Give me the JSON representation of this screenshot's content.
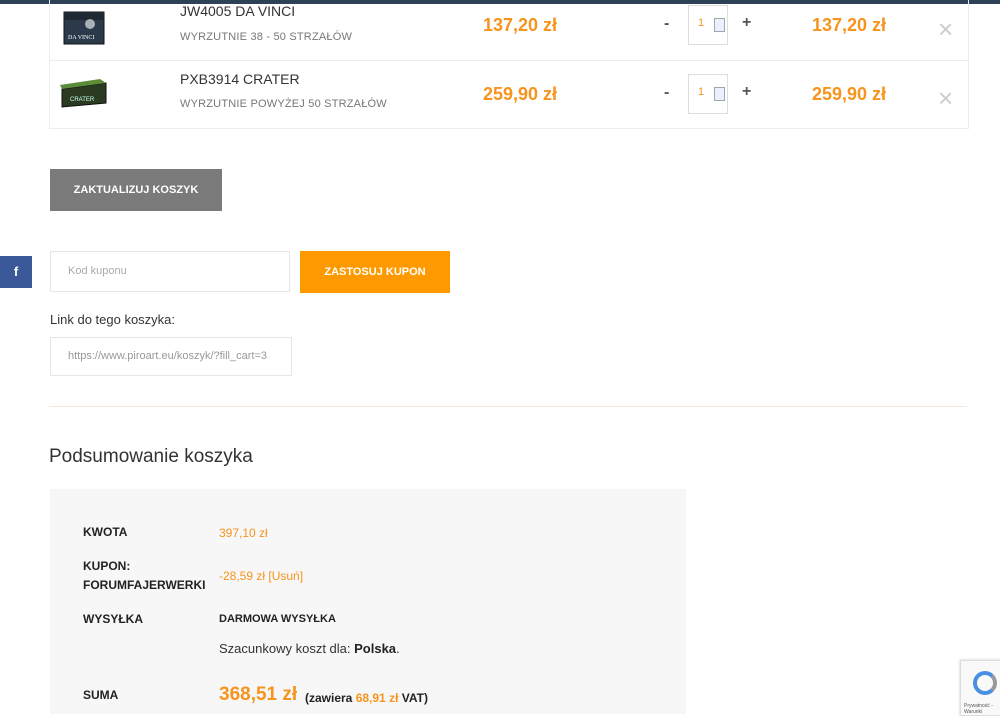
{
  "cart": {
    "items": [
      {
        "name": "JW4005 DA VINCI",
        "category": "WYRZUTNIE 38 - 50 STRZAŁÓW",
        "price": "137,20 zł",
        "minus": "-",
        "qty": "1",
        "plus": "+",
        "total": "137,20 zł",
        "remove": "×"
      },
      {
        "name": "PXB3914 CRATER",
        "category": "WYRZUTNIE POWYŻEJ 50 STRZAŁÓW",
        "price": "259,90 zł",
        "minus": "-",
        "qty": "1",
        "plus": "+",
        "total": "259,90 zł",
        "remove": "×"
      }
    ],
    "update_label": "ZAKTUALIZUJ KOSZYK"
  },
  "social": {
    "facebook": "f"
  },
  "coupon": {
    "placeholder": "Kod kuponu",
    "apply_label": "ZASTOSUJ KUPON"
  },
  "cart_link": {
    "label": "Link do tego koszyka:",
    "value": "https://www.piroart.eu/koszyk/?fill_cart=3"
  },
  "summary": {
    "title": "Podsumowanie koszyka",
    "kwota_label": "KWOTA",
    "kwota_value": "397,10 zł",
    "kupon_label_1": "KUPON:",
    "kupon_label_2": "FORUMFAJERWERKI",
    "kupon_value": "-28,59 zł [Usuń]",
    "wysylka_label": "WYSYŁKA",
    "wysylka_value": "DARMOWA WYSYŁKA",
    "estimate_text": "Szacunkowy koszt dla: ",
    "estimate_country": "Polska",
    "estimate_end": ".",
    "suma_label": "SUMA",
    "suma_value": "368,51 zł",
    "vat_pre": "(zawiera ",
    "vat_amount": "68,91 zł",
    "vat_post": " VAT)"
  },
  "captcha": {
    "text": "Prywatność - Warunki"
  },
  "colors": {
    "accent": "#ff9900",
    "price": "#f7941d",
    "facebook": "#3b5998",
    "update_button": "#7a7a7a"
  }
}
